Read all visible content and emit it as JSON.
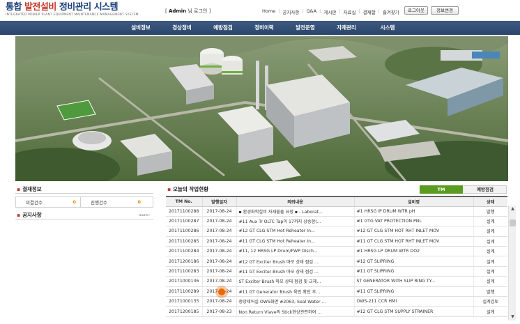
{
  "header": {
    "logo_ko_a": "통합 ",
    "logo_ko_b": "발전설비",
    "logo_ko_c": " 정비관리 시스템",
    "logo_en": "INTEGRATED POWER PLANT EQUIPMENT MAINTENANCE MANAGEMENT SYSTEM",
    "user_open": "[",
    "user_name": "Admin",
    "user_suffix": "님",
    "logout": "로그인",
    "user_close": "]",
    "links": [
      "Home",
      "공지사항",
      "Q&A",
      "게시판",
      "자료실",
      "결재함",
      "즐겨찾기"
    ],
    "btn_logout": "로그아웃",
    "btn_profile": "정보변경"
  },
  "nav": [
    "설비정보",
    "경상정비",
    "예방점검",
    "정비이력",
    "발전운영",
    "자재관리",
    "시스템"
  ],
  "approval": {
    "title": "결재정보",
    "pending_label": "미결건수",
    "pending_value": "0",
    "progress_label": "진행건수",
    "progress_value": "0"
  },
  "notice": {
    "title": "공지사항",
    "more": "more+"
  },
  "work": {
    "title": "오늘의 작업현황",
    "tab_active": "TM",
    "tab_inactive": "예방점검",
    "columns": [
      "TM No.",
      "발행일자",
      "의뢰내용",
      "설비명",
      "상태"
    ],
    "rows": [
      [
        "20171100288",
        "2017-08-24",
        "▪ 환경화학설비 자재불출 요청 ▪ - Laborat...",
        "#1 HRSG IP DRUM WTR pH",
        "발행"
      ],
      [
        "20171100287",
        "2017-08-24",
        "#11 Aux Tr OLTC Tap이 17까지 상승함(...",
        "#1 GTG VAT PROTECTION PNL",
        "설계"
      ],
      [
        "20171100286",
        "2017-08-24",
        "#12 GT CLG STM Hot Reheater In...",
        "#12 GT CLG STM HOT RHT INLET MOV",
        "설계"
      ],
      [
        "20171100285",
        "2017-08-24",
        "#11 GT CLG STM Hot Reheater In...",
        "#11 GT CLG STM HOT RHT INLET MOV",
        "설계"
      ],
      [
        "20171100284",
        "2017-08-24",
        "#11, 12 HRSG LP Drum/FWP Disch...",
        "#1 HRSG LP DRUM WTR DO2",
        "설계"
      ],
      [
        "20171200186",
        "2017-08-24",
        "#12 GT Exciter Brush 마모 상태 점검 ...",
        "#12 GT SLIPRING",
        "설계"
      ],
      [
        "20171100283",
        "2017-08-24",
        "#11 GT Exciter Brush 마모 상태 점검 ...",
        "#11 GT SLIPRING",
        "설계"
      ],
      [
        "20171000136",
        "2017-08-24",
        "ST Exciter Brush 마모 상태 점검 및 교체...",
        "ST GENERATOR WITH SLIP RING TY...",
        "설계"
      ],
      [
        "20171100289",
        "2017-08-24",
        "#11 GT Generator Brush 육안 확인 후...",
        "#11 GT SLIPRING",
        "발행"
      ],
      [
        "20171000135",
        "2017-08-24",
        "중앙제어실 OWS화면 #2063, Seal Water ...",
        "OWS-211 CCR HMI",
        "설계검토"
      ],
      [
        "20171200185",
        "2017-08-23",
        "Non Return Vlave의 Stick현상관련하여 ...",
        "#12 GT CLG STM SUPPLY STRAINER",
        "설계"
      ]
    ]
  },
  "colors": {
    "nav": "#2e4a6f",
    "tab_active": "#5a9c21",
    "accent": "#c0392b",
    "count": "#e08a00"
  },
  "scrollbar": {
    "up": "▲",
    "down": "▼"
  }
}
